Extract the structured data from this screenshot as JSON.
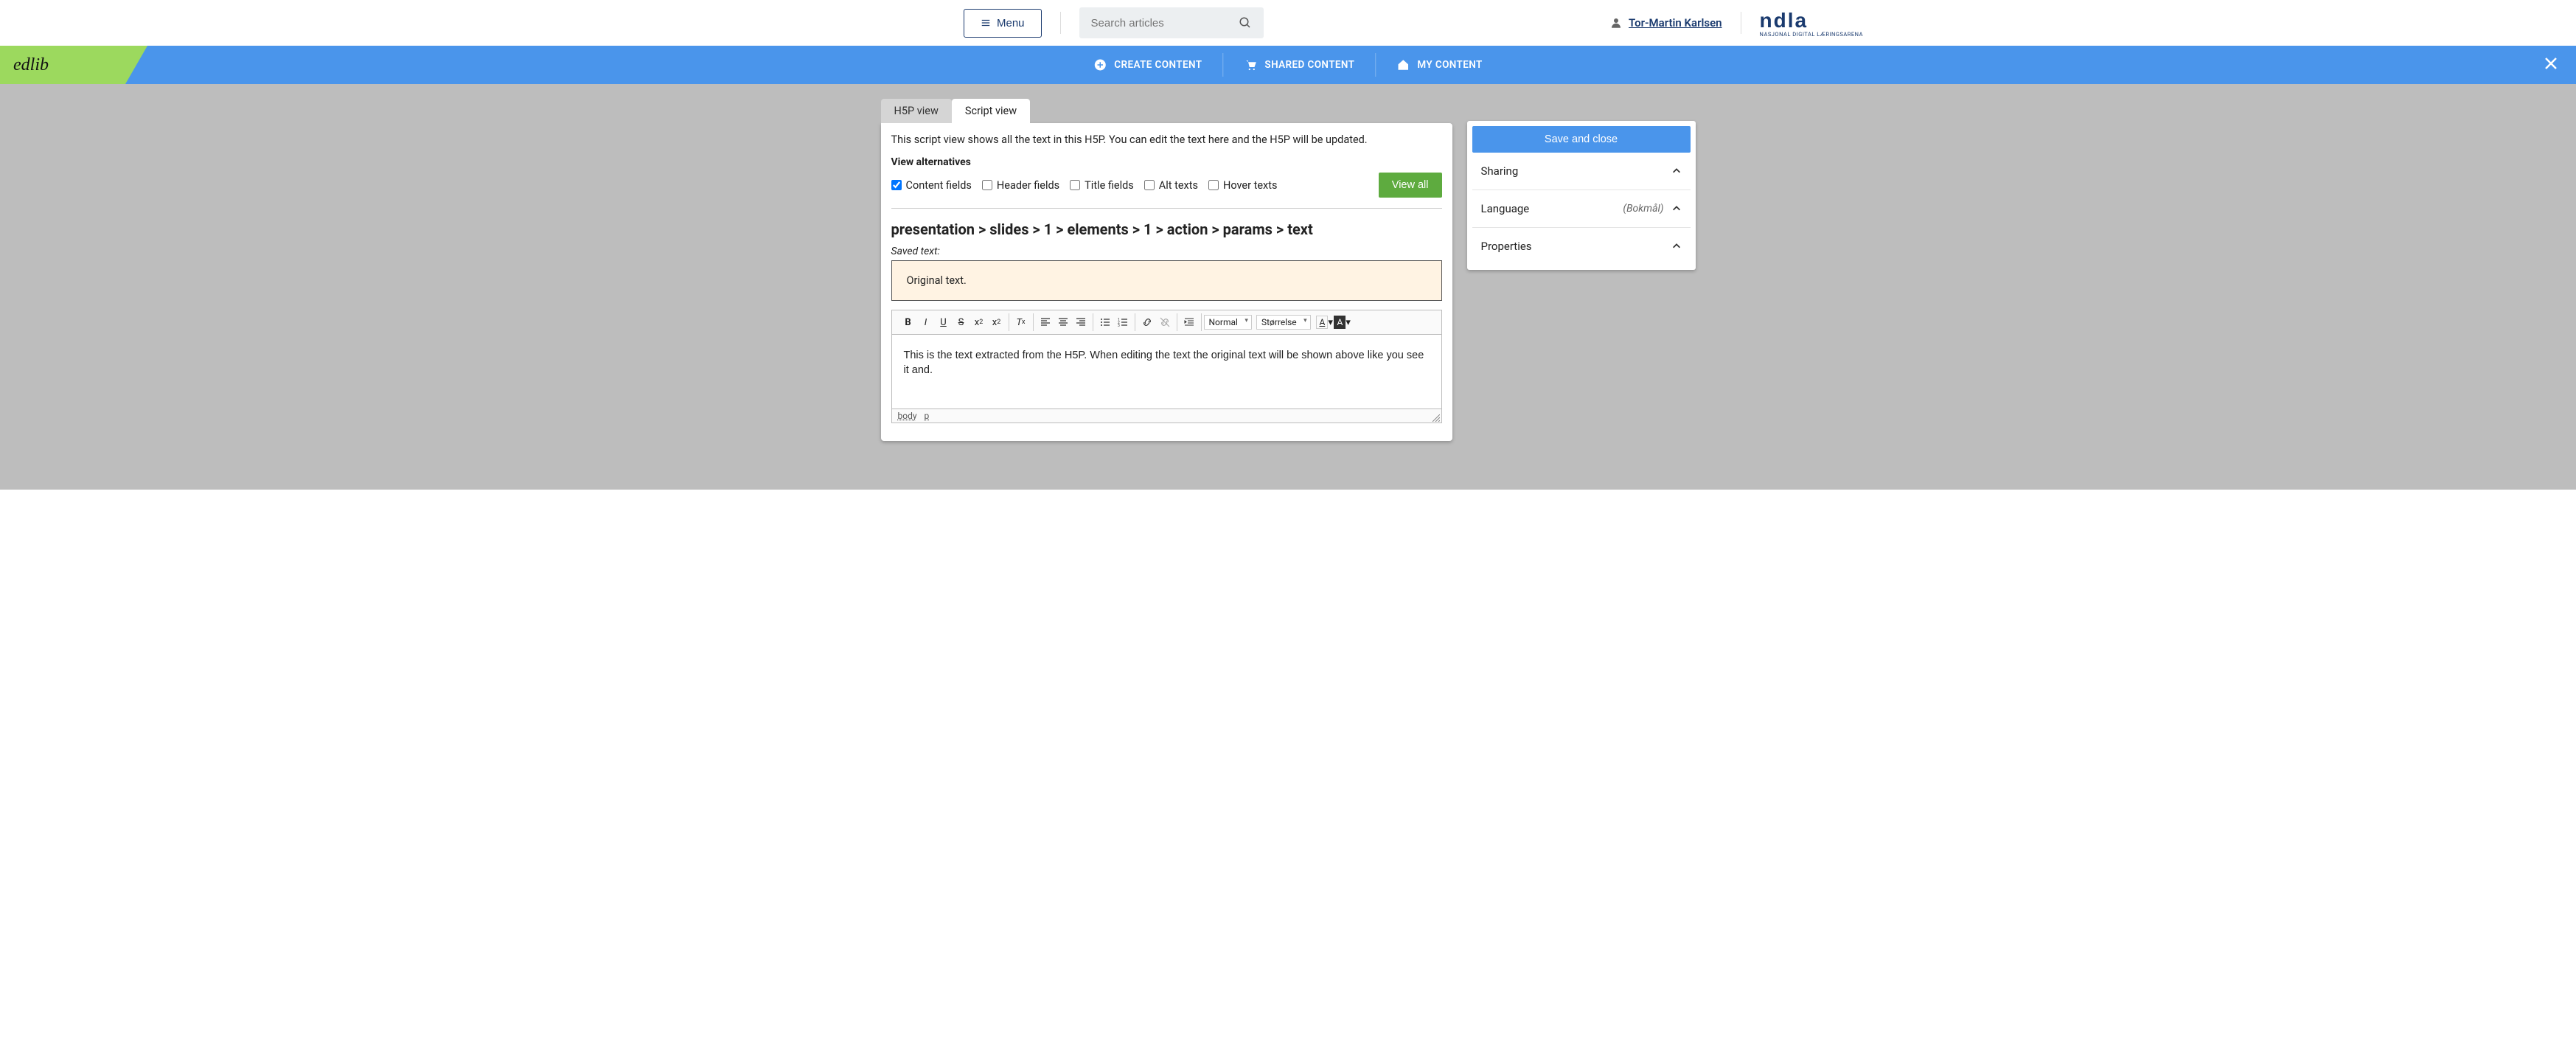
{
  "header": {
    "menu_label": "Menu",
    "search_placeholder": "Search articles",
    "user_name": "Tor-Martin Karlsen",
    "logo_main": "ndla",
    "logo_sub": "NASJONAL DIGITAL LÆRINGSARENA"
  },
  "bluebar": {
    "product": "edlib",
    "create": "CREATE CONTENT",
    "shared": "SHARED CONTENT",
    "mine": "MY CONTENT"
  },
  "tabs": {
    "h5p": "H5P view",
    "script": "Script view"
  },
  "editor": {
    "intro": "This script view shows all the text in this H5P. You can edit the text here and the H5P will be updated.",
    "view_alt_label": "View alternatives",
    "checks": {
      "content": "Content fields",
      "header": "Header fields",
      "title": "Title fields",
      "alt": "Alt texts",
      "hover": "Hover texts"
    },
    "view_all": "View all",
    "path_heading": "presentation > slides > 1 > elements > 1 > action > params > text",
    "saved_label": "Saved text:",
    "saved_text": "Original text.",
    "rte": {
      "para_style": "Normal",
      "size": "Størrelse",
      "body_text": "This is the text extracted from the H5P. When editing the text the original text will be shown above like you see it and.",
      "status_body": "body",
      "status_p": "p"
    }
  },
  "sidebar": {
    "save": "Save and close",
    "sharing": "Sharing",
    "language": "Language",
    "language_value": "(Bokmål)",
    "properties": "Properties"
  }
}
